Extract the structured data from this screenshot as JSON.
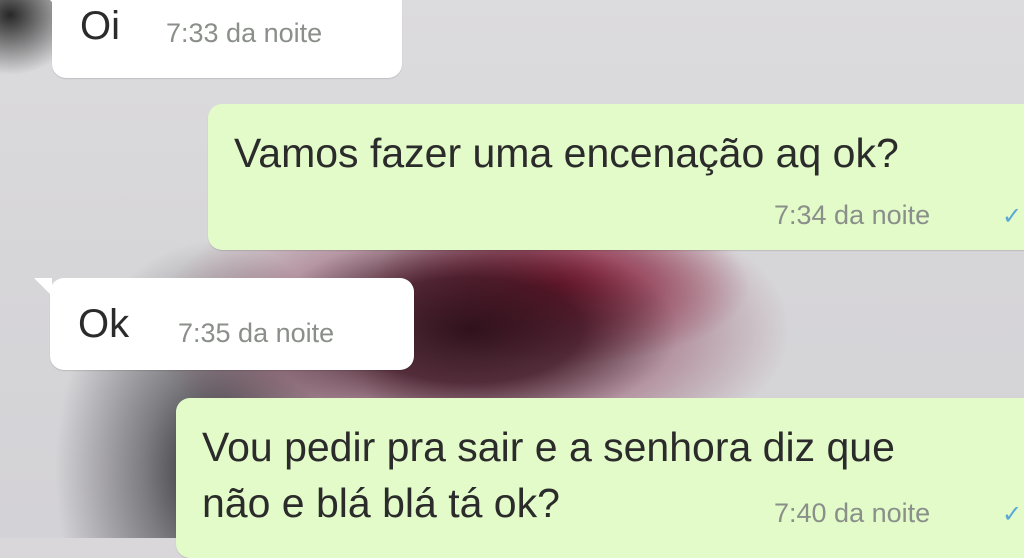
{
  "chat": {
    "messages": [
      {
        "direction": "incoming",
        "text": "Oi",
        "time": "7:33 da noite"
      },
      {
        "direction": "outgoing",
        "text": "Vamos fazer uma encenação aq ok?",
        "time": "7:34 da noite",
        "status_icon": "check-icon"
      },
      {
        "direction": "incoming",
        "text": "Ok",
        "time": "7:35 da noite"
      },
      {
        "direction": "outgoing",
        "lines": [
          "Vou pedir pra sair e a senhora diz que",
          "não e blá blá tá ok?"
        ],
        "time": "7:40 da noite",
        "status_icon": "check-icon"
      }
    ]
  },
  "colors": {
    "incoming_bubble": "#ffffff",
    "outgoing_bubble": "#e2fbc9",
    "timestamp": "#8a8f8a",
    "tick": "#5aa7d8"
  }
}
